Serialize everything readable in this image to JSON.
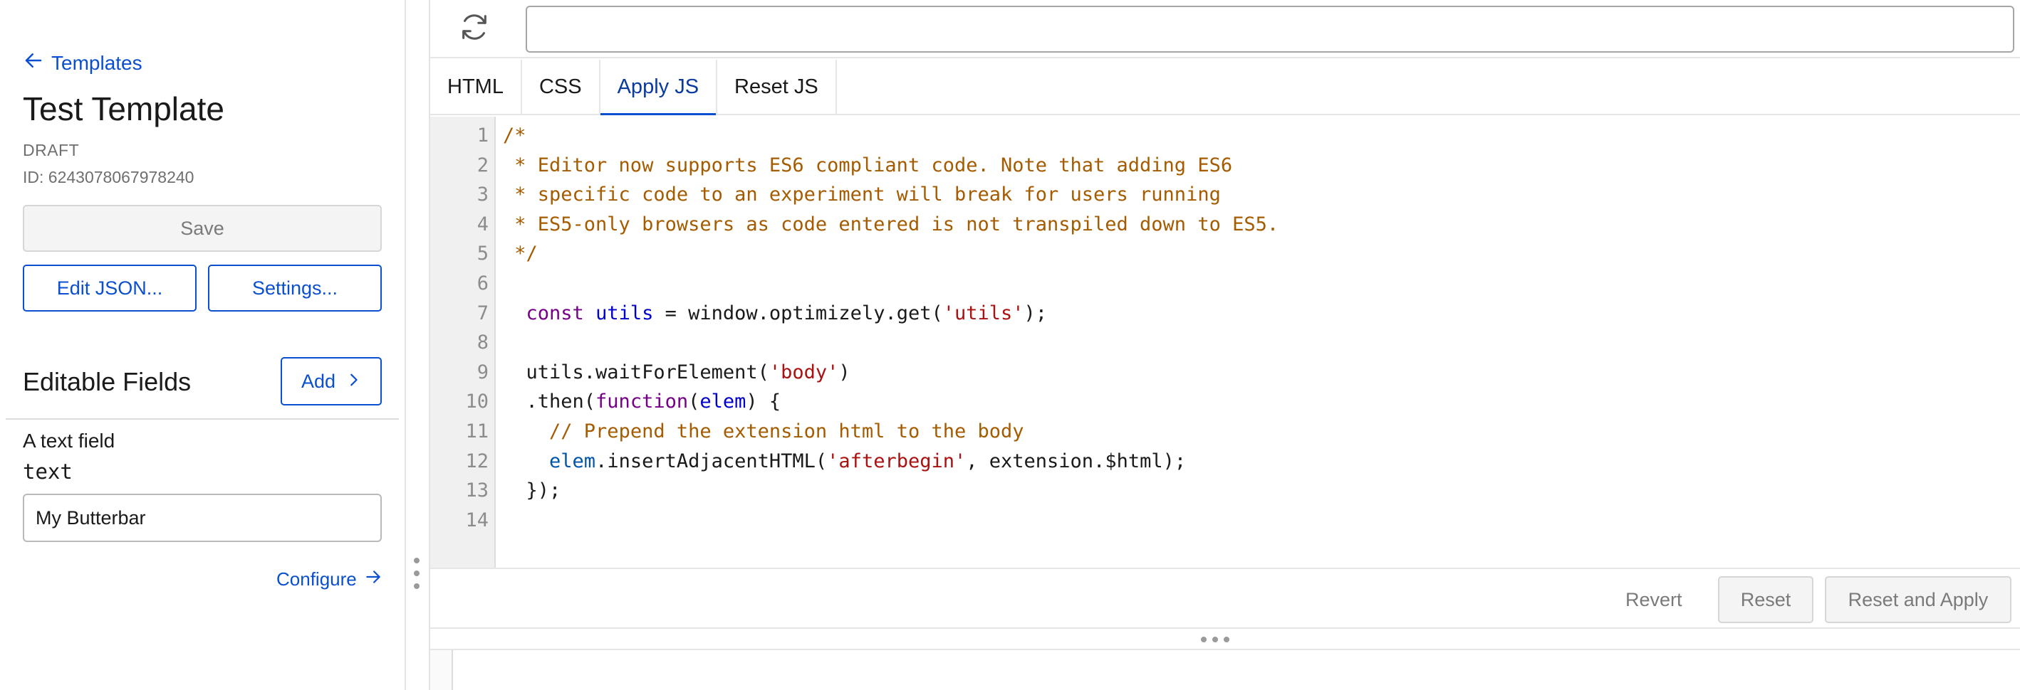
{
  "sidebar": {
    "back_link": "Templates",
    "title": "Test Template",
    "status": "DRAFT",
    "id_label": "ID: 6243078067978240",
    "save_label": "Save",
    "edit_json_label": "Edit JSON...",
    "settings_label": "Settings...",
    "editable_fields_title": "Editable Fields",
    "add_label": "Add",
    "field": {
      "label": "A text field",
      "key": "text",
      "value": "My Butterbar"
    },
    "configure_label": "Configure"
  },
  "editor": {
    "url_value": "",
    "tabs": [
      {
        "label": "HTML"
      },
      {
        "label": "CSS"
      },
      {
        "label": "Apply JS"
      },
      {
        "label": "Reset JS"
      }
    ],
    "active_tab": "Apply JS",
    "line_numbers": [
      "1",
      "2",
      "3",
      "4",
      "5",
      "6",
      "7",
      "8",
      "9",
      "10",
      "11",
      "12",
      "13",
      "14"
    ],
    "revert_label": "Revert",
    "reset_label": "Reset",
    "reset_apply_label": "Reset and Apply"
  },
  "code": [
    [
      {
        "t": "/*",
        "c": "comment"
      }
    ],
    [
      {
        "t": " * Editor now supports ES6 compliant code. Note that adding ES6",
        "c": "comment"
      }
    ],
    [
      {
        "t": " * specific code to an experiment will break for users running",
        "c": "comment"
      }
    ],
    [
      {
        "t": " * ES5-only browsers as code entered is not transpiled down to ES5.",
        "c": "comment"
      }
    ],
    [
      {
        "t": " */",
        "c": "comment"
      }
    ],
    [],
    [
      {
        "t": "  "
      },
      {
        "t": "const",
        "c": "keyword"
      },
      {
        "t": " "
      },
      {
        "t": "utils",
        "c": "def"
      },
      {
        "t": " = window.optimizely.get("
      },
      {
        "t": "'utils'",
        "c": "string"
      },
      {
        "t": ");"
      }
    ],
    [],
    [
      {
        "t": "  utils.waitForElement("
      },
      {
        "t": "'body'",
        "c": "string"
      },
      {
        "t": ")"
      }
    ],
    [
      {
        "t": "  .then("
      },
      {
        "t": "function",
        "c": "keyword"
      },
      {
        "t": "("
      },
      {
        "t": "elem",
        "c": "def"
      },
      {
        "t": ") {"
      }
    ],
    [
      {
        "t": "    "
      },
      {
        "t": "// Prepend the extension html to the body",
        "c": "comment"
      }
    ],
    [
      {
        "t": "    "
      },
      {
        "t": "elem",
        "c": "var"
      },
      {
        "t": ".insertAdjacentHTML("
      },
      {
        "t": "'afterbegin'",
        "c": "string"
      },
      {
        "t": ", extension.$html);"
      }
    ],
    [
      {
        "t": "  });"
      }
    ],
    []
  ],
  "colors": {
    "accent": "#0b4fd1",
    "comment": "#a55b00",
    "keyword": "#770088",
    "string": "#aa1111",
    "def": "#0000cc"
  },
  "icons": [
    "arrow-left-icon",
    "chevron-right-icon",
    "arrow-right-icon",
    "refresh-icon"
  ]
}
